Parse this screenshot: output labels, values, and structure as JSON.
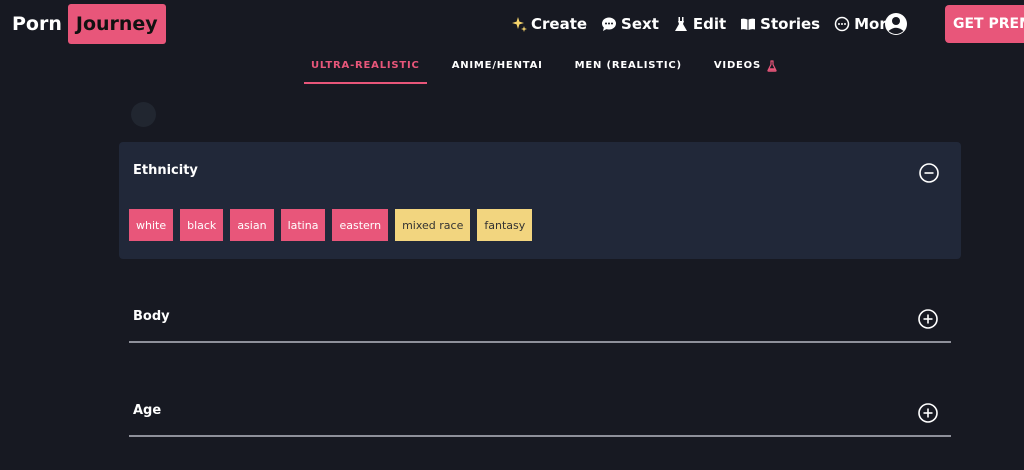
{
  "header": {
    "logo": {
      "first": "Porn",
      "second": "Journey"
    },
    "nav": [
      {
        "label": "Create",
        "icon": "sparkles-icon"
      },
      {
        "label": "Sext",
        "icon": "chat-bubble-icon"
      },
      {
        "label": "Edit",
        "icon": "dress-icon"
      },
      {
        "label": "Stories",
        "icon": "book-icon"
      },
      {
        "label": "More",
        "icon": "more-circle-icon"
      }
    ],
    "cta_label": "GET PREM",
    "colors": {
      "accent": "#e8567a"
    }
  },
  "tabs": [
    {
      "label": "ULTRA-REALISTIC",
      "active": true
    },
    {
      "label": "ANIME/HENTAI",
      "active": false
    },
    {
      "label": "MEN (REALISTIC)",
      "active": false
    },
    {
      "label": "VIDEOS",
      "active": false,
      "icon": "flask-icon"
    }
  ],
  "filters": {
    "ethnicity": {
      "title": "Ethnicity",
      "expanded": true,
      "options": [
        {
          "label": "white",
          "color": "#e8567a"
        },
        {
          "label": "black",
          "color": "#e8567a"
        },
        {
          "label": "asian",
          "color": "#e8567a"
        },
        {
          "label": "latina",
          "color": "#e8567a"
        },
        {
          "label": "eastern",
          "color": "#e8567a"
        },
        {
          "label": "mixed race",
          "color": "#f2d57f"
        },
        {
          "label": "fantasy",
          "color": "#f2d57f"
        }
      ]
    },
    "body": {
      "title": "Body",
      "expanded": false
    },
    "age": {
      "title": "Age",
      "expanded": false
    }
  }
}
